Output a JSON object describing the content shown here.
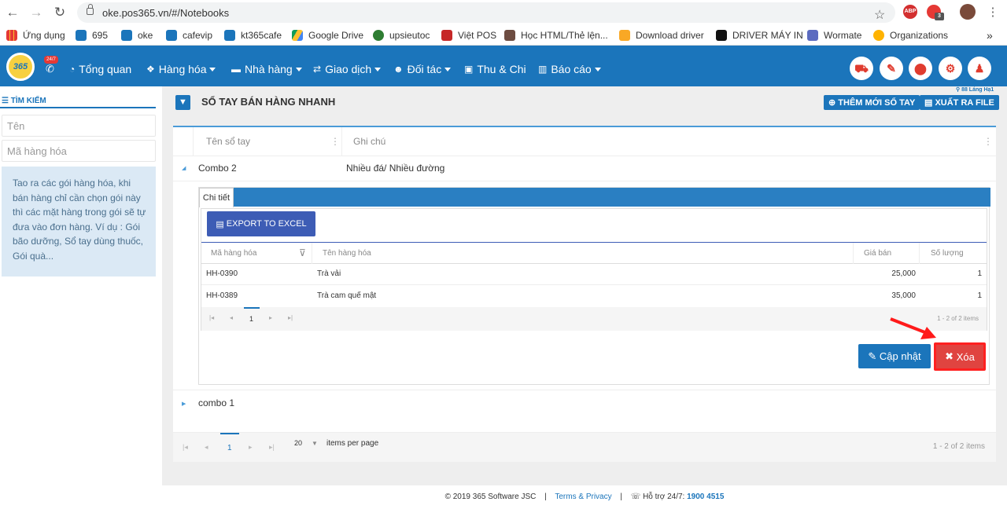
{
  "browser": {
    "url": "oke.pos365.vn/#/Notebooks",
    "ext_abp": "ABP",
    "ext_badge": "3",
    "bookmarks": [
      "Ứng dụng",
      "695",
      "oke",
      "cafevip",
      "kt365cafe",
      "Google Drive",
      "upsieutoc",
      "Việt POS",
      "Học HTML/Thẻ lện...",
      "Download driver",
      "DRIVER MÁY IN",
      "Wormate",
      "Organizations"
    ],
    "more": "»"
  },
  "app": {
    "logo": "365",
    "badge": "24/7",
    "menu": [
      "Tổng quan",
      "Hàng hóa",
      "Nhà hàng",
      "Giao dịch",
      "Đối tác",
      "Thu & Chi",
      "Báo cáo"
    ],
    "location": "88 Láng Hạ1"
  },
  "sidebar": {
    "title": "TÌM KIẾM",
    "name_placeholder": "Tên",
    "code_placeholder": "Mã hàng hóa",
    "hint": "Tao ra các gói hàng hóa, khi bán hàng chỉ cần chọn gói này thì các mặt hàng trong gói sẽ tự đưa vào đơn hàng. Ví dụ : Gói bão dưỡng, Sổ tay dùng thuốc, Gói quà..."
  },
  "main": {
    "title": "SỔ TAY BÁN HÀNG NHANH",
    "add_button": "THÊM MỚI SỔ TAY",
    "export_button": "XUẤT RA FILE",
    "columns": [
      "Tên sổ tay",
      "Ghi chú"
    ],
    "rows": [
      {
        "name": "Combo 2",
        "note": "Nhiều đá/ Nhiều đường"
      },
      {
        "name": "combo 1",
        "note": ""
      }
    ],
    "detail": {
      "tab": "Chi tiết",
      "export_excel": "EXPORT TO EXCEL",
      "columns": [
        "Mã hàng hóa",
        "Tên hàng hóa",
        "Giá bán",
        "Số lượng"
      ],
      "items": [
        {
          "code": "HH-0390",
          "name": "Trà vải",
          "price": "25,000",
          "qty": "1"
        },
        {
          "code": "HH-0389",
          "name": "Trà cam quế mật",
          "price": "35,000",
          "qty": "1"
        }
      ],
      "page": "1",
      "page_info": "1 - 2 of 2 items",
      "update_button": "Cập nhật",
      "delete_button": "Xóa"
    },
    "pager": {
      "page": "1",
      "per_page": "20",
      "per_page_label": "items per page",
      "info": "1 - 2 of 2 items"
    }
  },
  "footer": {
    "copyright": "© 2019 365 Software JSC",
    "terms": "Terms & Privacy",
    "support_label": "Hỗ trợ 24/7:",
    "phone": "1900 4515"
  }
}
